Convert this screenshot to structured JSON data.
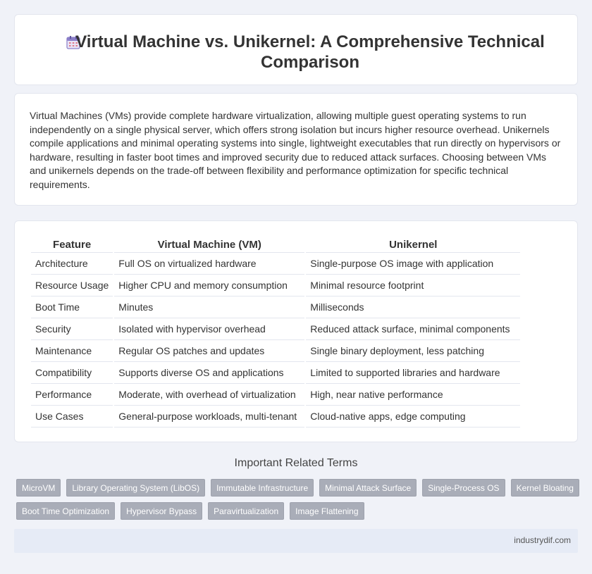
{
  "header": {
    "icon": "calendar-icon",
    "title": "Virtual Machine vs. Unikernel: A Comprehensive Technical Comparison"
  },
  "intro": {
    "text": "Virtual Machines (VMs) provide complete hardware virtualization, allowing multiple guest operating systems to run independently on a single physical server, which offers strong isolation but incurs higher resource overhead. Unikernels compile applications and minimal operating systems into single, lightweight executables that run directly on hypervisors or hardware, resulting in faster boot times and improved security due to reduced attack surfaces. Choosing between VMs and unikernels depends on the trade-off between flexibility and performance optimization for specific technical requirements."
  },
  "table": {
    "headers": [
      "Feature",
      "Virtual Machine (VM)",
      "Unikernel"
    ],
    "rows": [
      [
        "Architecture",
        "Full OS on virtualized hardware",
        "Single-purpose OS image with application"
      ],
      [
        "Resource Usage",
        "Higher CPU and memory consumption",
        "Minimal resource footprint"
      ],
      [
        "Boot Time",
        "Minutes",
        "Milliseconds"
      ],
      [
        "Security",
        "Isolated with hypervisor overhead",
        "Reduced attack surface, minimal components"
      ],
      [
        "Maintenance",
        "Regular OS patches and updates",
        "Single binary deployment, less patching"
      ],
      [
        "Compatibility",
        "Supports diverse OS and applications",
        "Limited to supported libraries and hardware"
      ],
      [
        "Performance",
        "Moderate, with overhead of virtualization",
        "High, near native performance"
      ],
      [
        "Use Cases",
        "General-purpose workloads, multi-tenant",
        "Cloud-native apps, edge computing"
      ]
    ]
  },
  "related": {
    "title": "Important Related Terms",
    "tags": [
      "MicroVM",
      "Library Operating System (LibOS)",
      "Immutable Infrastructure",
      "Minimal Attack Surface",
      "Single-Process OS",
      "Kernel Bloating",
      "Boot Time Optimization",
      "Hypervisor Bypass",
      "Paravirtualization",
      "Image Flattening"
    ]
  },
  "footer": {
    "site": "industrydif.com"
  },
  "colors": {
    "background": "#f0f2f8",
    "tag": "#a9adb8",
    "footer": "#e6ebf6"
  }
}
